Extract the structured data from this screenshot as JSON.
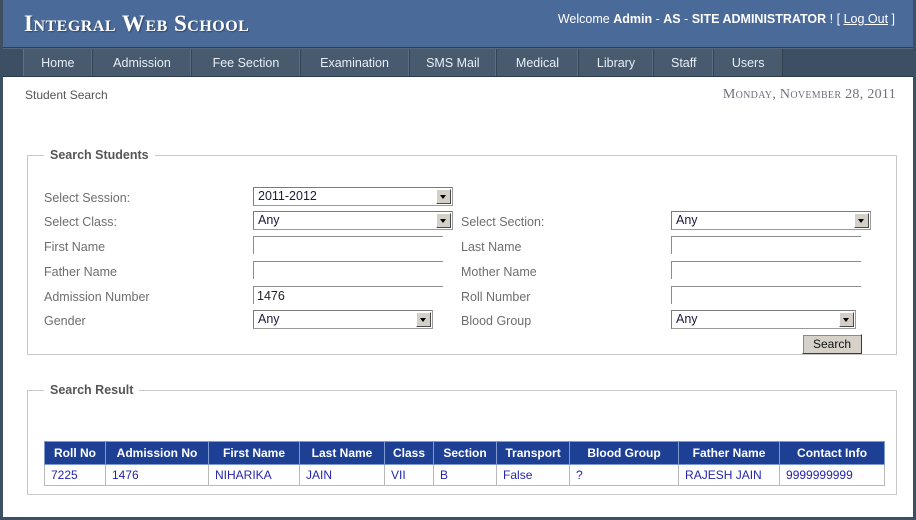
{
  "header": {
    "brand": "Integral Web School",
    "welcome_prefix": "Welcome ",
    "user": "Admin",
    "sep1": " - ",
    "user_code": "AS",
    "sep2": " - ",
    "role": "SITE ADMINISTRATOR",
    "excl": " ! [ ",
    "logout": "Log Out",
    "bracket_close": " ]"
  },
  "nav": {
    "items": [
      {
        "label": "Home",
        "width": 73
      },
      {
        "label": "Admission",
        "width": 106
      },
      {
        "label": "Fee Section",
        "width": 115
      },
      {
        "label": "Examination",
        "width": 116
      },
      {
        "label": "SMS Mail",
        "width": 93
      },
      {
        "label": "Medical",
        "width": 87
      },
      {
        "label": "Library",
        "width": 80
      },
      {
        "label": "Staff",
        "width": 64
      },
      {
        "label": "Users",
        "width": 72
      }
    ]
  },
  "subheader": {
    "breadcrumb": "Student Search",
    "date": "Monday, November 28, 2011"
  },
  "search_form": {
    "legend": "Search Students",
    "fields": {
      "session": {
        "label": "Select Session:",
        "value": "2011-2012",
        "type": "select"
      },
      "class": {
        "label": "Select Class:",
        "value": "Any",
        "type": "select"
      },
      "section": {
        "label": "Select Section:",
        "value": "Any",
        "type": "select"
      },
      "first_name": {
        "label": "First Name",
        "value": "",
        "type": "text"
      },
      "last_name": {
        "label": "Last Name",
        "value": "",
        "type": "text"
      },
      "father_name": {
        "label": "Father Name",
        "value": "",
        "type": "text"
      },
      "mother_name": {
        "label": "Mother Name",
        "value": "",
        "type": "text"
      },
      "admission_number": {
        "label": "Admission Number",
        "value": "1476",
        "type": "text"
      },
      "roll_number": {
        "label": "Roll Number",
        "value": "",
        "type": "text"
      },
      "gender": {
        "label": "Gender",
        "value": "Any",
        "type": "select"
      },
      "blood_group": {
        "label": "Blood Group",
        "value": "Any",
        "type": "select"
      }
    },
    "search_button": "Search"
  },
  "result": {
    "legend": "Search Result",
    "columns": [
      "Roll No",
      "Admission No",
      "First Name",
      "Last Name",
      "Class",
      "Section",
      "Transport",
      "Blood Group",
      "Father Name",
      "Contact Info"
    ],
    "rows": [
      {
        "roll_no": "7225",
        "admission_no": "1476",
        "first_name": "NIHARIKA",
        "last_name": "JAIN",
        "class": "VII",
        "section": "B",
        "transport": "False",
        "blood_group": "?",
        "father_name": "RAJESH JAIN",
        "contact_info": "9999999999"
      }
    ]
  },
  "colors": {
    "banner_blue": "#4a6a9a",
    "nav_dark": "#3d4f63",
    "nav_item": "#475a6e",
    "table_header_blue": "#1d3f94",
    "table_text_blue": "#2424ab",
    "label_grey": "#6e6e6e",
    "frame_border": "#3c4f63"
  }
}
